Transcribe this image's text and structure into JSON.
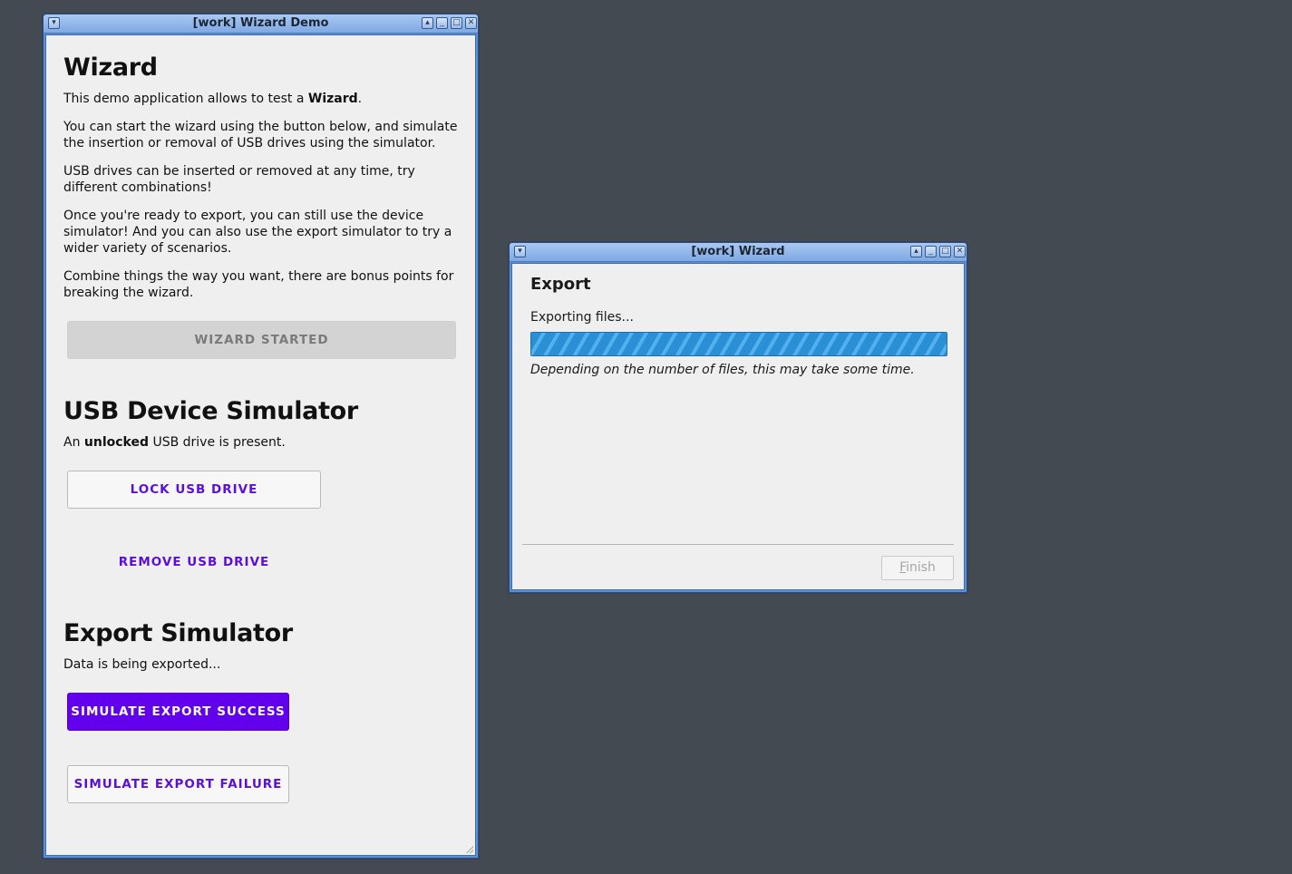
{
  "main_window": {
    "title": "[work] Wizard Demo",
    "wizard_section": {
      "heading": "Wizard",
      "intro_prefix": "This demo application allows to test a ",
      "intro_bold": "Wizard",
      "intro_suffix": ".",
      "para_start": "You can start the wizard using the button below, and simulate the insertion or removal of USB drives using the simulator.",
      "para_usb": "USB drives can be inserted or removed at any time, try different combinations!",
      "para_export": "Once you're ready to export, you can still use the device simulator! And you can also use the export simulator to try a wider variety of scenarios.",
      "para_combine": "Combine things the way you want, there are bonus points for breaking the wizard.",
      "start_button_label": "WIZARD STARTED"
    },
    "usb_section": {
      "heading": "USB Device Simulator",
      "status_prefix": "An ",
      "status_bold": "unlocked",
      "status_suffix": " USB drive is present.",
      "lock_button_label": "LOCK USB DRIVE",
      "remove_button_label": "REMOVE USB DRIVE"
    },
    "export_section": {
      "heading": "Export Simulator",
      "status": "Data is being exported...",
      "success_button_label": "SIMULATE EXPORT SUCCESS",
      "failure_button_label": "SIMULATE EXPORT FAILURE"
    }
  },
  "wizard_window": {
    "title": "[work] Wizard",
    "page_title": "Export",
    "status": "Exporting files...",
    "progress_fraction": 1.0,
    "note": "Depending on the number of files, this may take some time.",
    "finish_mnemonic": "F",
    "finish_rest": "inish"
  },
  "icons": {
    "menu": "menu-icon",
    "shade": "shade-icon",
    "minimize": "minimize-icon",
    "maximize": "maximize-icon",
    "close": "close-icon"
  },
  "colors": {
    "desktop": "#434a52",
    "accent": "#6200ee",
    "progress": "#2f97de"
  }
}
